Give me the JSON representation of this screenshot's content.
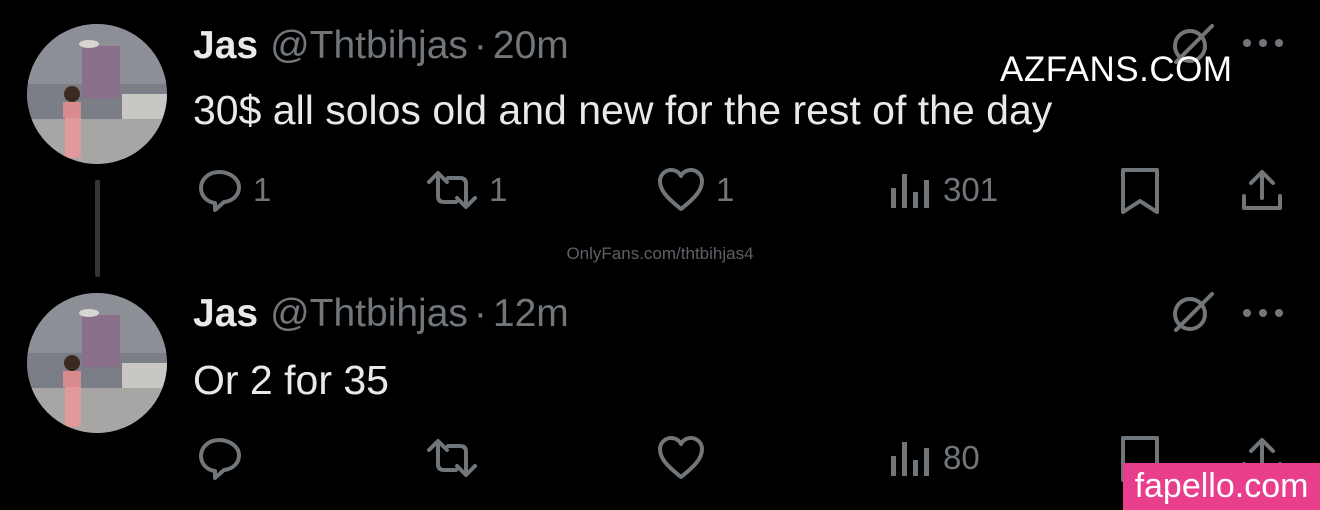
{
  "tweets": [
    {
      "name": "Jas",
      "handle": "@Thtbihjas",
      "separator": "·",
      "time": "20m",
      "text": "30$ all solos old and new for the rest of the day",
      "replies": "1",
      "reposts": "1",
      "likes": "1",
      "views": "301"
    },
    {
      "name": "Jas",
      "handle": "@Thtbihjas",
      "separator": "·",
      "time": "12m",
      "text": "Or 2 for 35",
      "replies": "",
      "reposts": "",
      "likes": "",
      "views": "80"
    }
  ],
  "watermarks": {
    "azfans": "AZFANS.COM",
    "onlyfans": "OnlyFans.com/thtbihjas4",
    "fapello": "fapello.com"
  },
  "colors": {
    "background": "#000000",
    "text": "#e7e9ea",
    "secondary": "#71767b",
    "fapello_pink": "#e83e8c"
  },
  "icons": [
    "reply-icon",
    "repost-icon",
    "like-icon",
    "views-icon",
    "bookmark-icon",
    "share-icon",
    "grok-icon",
    "more-icon"
  ]
}
